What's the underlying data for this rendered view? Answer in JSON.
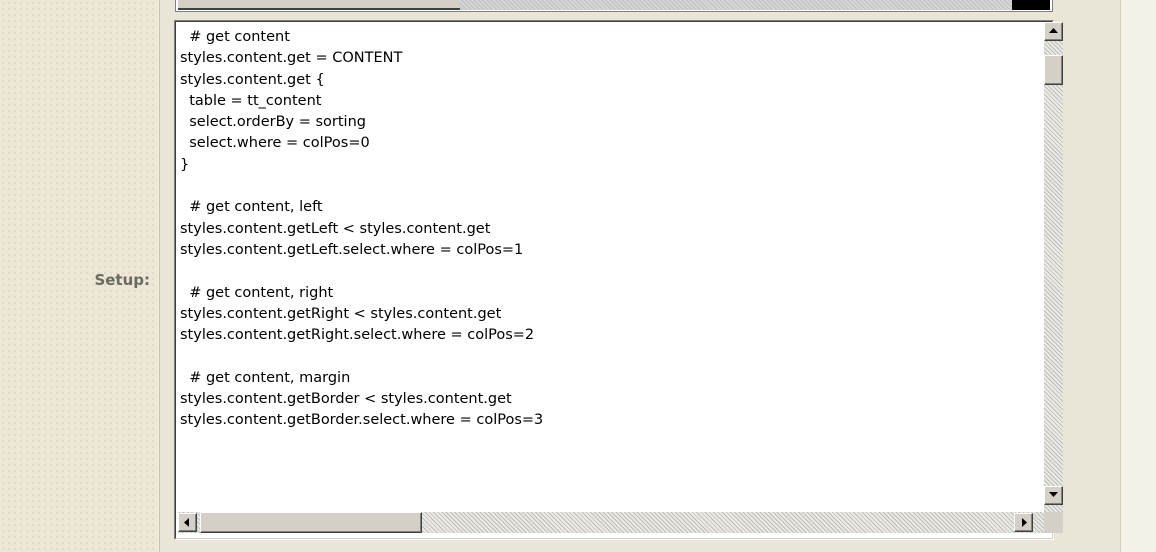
{
  "form": {
    "setup_label": "Setup:"
  },
  "editor": {
    "code": "  # get content\nstyles.content.get = CONTENT\nstyles.content.get {\n  table = tt_content\n  select.orderBy = sorting\n  select.where = colPos=0\n}\n\n  # get content, left\nstyles.content.getLeft < styles.content.get\nstyles.content.getLeft.select.where = colPos=1\n\n  # get content, right\nstyles.content.getRight < styles.content.get\nstyles.content.getRight.select.where = colPos=2\n\n  # get content, margin\nstyles.content.getBorder < styles.content.get\nstyles.content.getBorder.select.where = colPos=3"
  },
  "icons": {
    "scroll_up": "arrow-up-icon",
    "scroll_down": "arrow-down-icon",
    "scroll_left": "arrow-left-icon",
    "scroll_right": "arrow-right-icon"
  },
  "colors": {
    "label_gray": "#6a6a5e",
    "panel_bg": "#e9e5d7",
    "textarea_bg": "#ffffff",
    "scrollbar_face": "#d4d0c8"
  }
}
